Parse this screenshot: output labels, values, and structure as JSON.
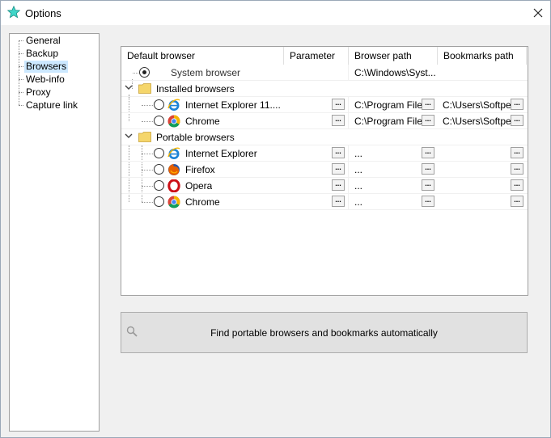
{
  "window": {
    "title": "Options"
  },
  "nav": {
    "items": [
      {
        "label": "General",
        "selected": false
      },
      {
        "label": "Backup",
        "selected": false
      },
      {
        "label": "Browsers",
        "selected": true
      },
      {
        "label": "Web-info",
        "selected": false
      },
      {
        "label": "Proxy",
        "selected": false
      },
      {
        "label": "Capture link",
        "selected": false
      }
    ]
  },
  "grid": {
    "columns": [
      "Default browser",
      "Parameter",
      "Browser path",
      "Bookmarks path"
    ],
    "system_row": {
      "label": "System browser",
      "browser_path": "C:\\Windows\\Syst...",
      "selected": true
    },
    "installed_group": {
      "label": "Installed browsers",
      "rows": [
        {
          "name": "Internet Explorer 11....",
          "icon": "internet-explorer-icon",
          "browser_path": "C:\\Program Files",
          "bookmarks_path": "C:\\Users\\Softpec"
        },
        {
          "name": "Chrome",
          "icon": "chrome-icon",
          "browser_path": "C:\\Program Files",
          "bookmarks_path": "C:\\Users\\Softpec"
        }
      ]
    },
    "portable_group": {
      "label": "Portable browsers",
      "rows": [
        {
          "name": "Internet Explorer",
          "icon": "internet-explorer-icon",
          "browser_path": "...",
          "bookmarks_path": ""
        },
        {
          "name": "Firefox",
          "icon": "firefox-icon",
          "browser_path": "...",
          "bookmarks_path": ""
        },
        {
          "name": "Opera",
          "icon": "opera-icon",
          "browser_path": "...",
          "bookmarks_path": ""
        },
        {
          "name": "Chrome",
          "icon": "chrome-icon",
          "browser_path": "...",
          "bookmarks_path": ""
        }
      ]
    },
    "ellipsis_label": "..."
  },
  "find_button": {
    "label": "Find portable browsers and bookmarks automatically",
    "icon": "magnifier-icon"
  },
  "colors": {
    "selected_nav": "#cce8ff",
    "window_bg": "#f0f0f0",
    "button_bg": "#e1e1e1"
  }
}
